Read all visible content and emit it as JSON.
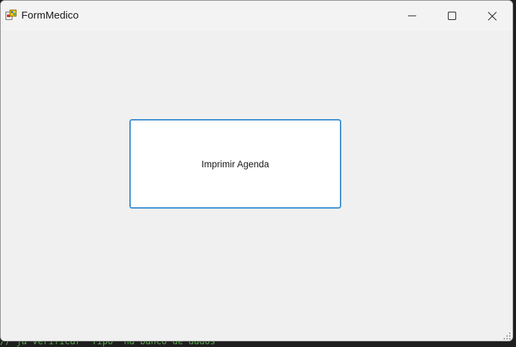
{
  "window": {
    "title": "FormMedico",
    "icon": "winforms-app-icon",
    "controls": {
      "minimize": "minimize-icon",
      "maximize": "maximize-icon",
      "close": "close-icon"
    }
  },
  "form": {
    "print_button_label": "Imprimir Agenda"
  },
  "background_editor": {
    "code_line": "// ja verificar \"Tipo\" na banco de dados"
  },
  "colors": {
    "button_border": "#3c8fd4",
    "client_background": "#f0f0f0",
    "titlebar_background": "#f3f3f3",
    "editor_comment": "#57a64a"
  }
}
